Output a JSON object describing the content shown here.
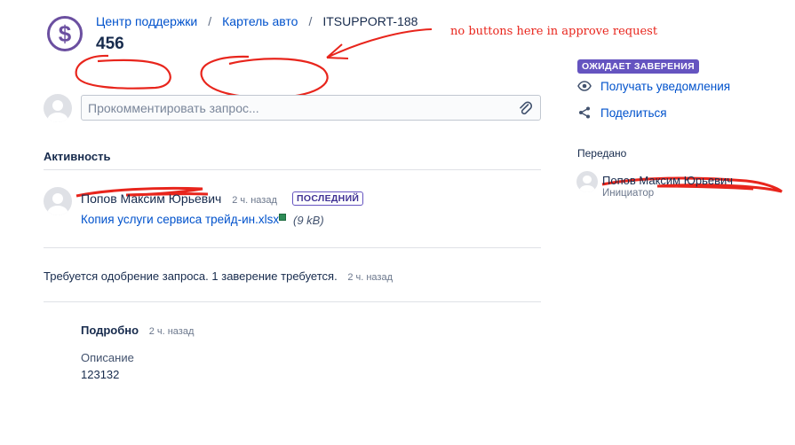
{
  "header": {
    "breadcrumb": [
      "Центр поддержки",
      "Картель авто",
      "ITSUPPORT-188"
    ],
    "separator": "/",
    "title": "456",
    "logo_symbol": "$"
  },
  "annotation": {
    "text": "no buttons here in approve request",
    "color": "#e8251c"
  },
  "comment_box": {
    "placeholder": "Прокомментировать запрос...",
    "value": "",
    "attach_icon": "paperclip-icon"
  },
  "activity": {
    "title": "Активность",
    "entries": [
      {
        "author": "Попов Максим Юрьевич",
        "time": "2 ч. назад",
        "badge": "ПОСЛЕДНИЙ",
        "attachment_name": "Копия услуги сервиса трейд-ин.xlsx",
        "attachment_size": "(9 kB)"
      }
    ],
    "approval_text": "Требуется одобрение запроса. 1 заверение требуется.",
    "approval_time": "2 ч. назад",
    "details_title": "Подробно",
    "details_time": "2 ч. назад",
    "description_label": "Описание",
    "description_value": "123132"
  },
  "sidebar": {
    "status": "ОЖИДАЕТ ЗАВЕРЕНИЯ",
    "status_color": "#6554c0",
    "actions": [
      {
        "label": "Получать уведомления",
        "icon": "eye-icon"
      },
      {
        "label": "Поделиться",
        "icon": "share-icon"
      }
    ],
    "handed_over_label": "Передано",
    "person_name": "Попов Максим Юрьевич",
    "person_role": "Инициатор"
  }
}
